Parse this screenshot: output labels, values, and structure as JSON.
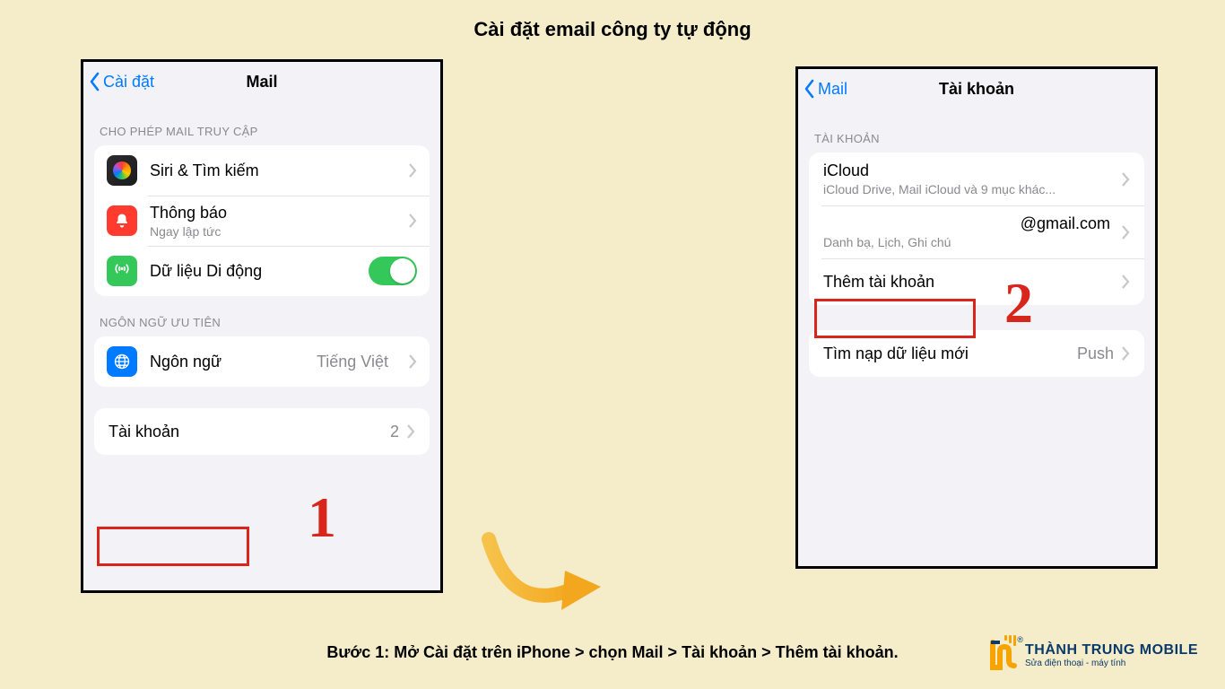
{
  "page_title": "Cài đặt email công ty tự động",
  "caption": "Bước 1: Mở Cài đặt trên iPhone > chọn Mail > Tài khoản > Thêm tài khoản.",
  "annotation": {
    "marker1": "1",
    "marker2": "2"
  },
  "phone_left": {
    "back": "Cài đặt",
    "title": "Mail",
    "section1_header": "CHO PHÉP MAIL TRUY CẬP",
    "rows1": {
      "siri": "Siri & Tìm kiếm",
      "notif_label": "Thông báo",
      "notif_sub": "Ngay lập tức",
      "cellular": "Dữ liệu Di động"
    },
    "section2_header": "NGÔN NGỮ ƯU TIÊN",
    "language_label": "Ngôn ngữ",
    "language_value": "Tiếng Việt",
    "accounts_label": "Tài khoản",
    "accounts_value": "2"
  },
  "phone_right": {
    "back": "Mail",
    "title": "Tài khoản",
    "section_header": "TÀI KHOẢN",
    "icloud_label": "iCloud",
    "icloud_sub": "iCloud Drive, Mail iCloud và 9 mục khác...",
    "gmail_label": "@gmail.com",
    "gmail_sub": "Danh bạ, Lịch, Ghi chú",
    "add_label": "Thêm tài khoản",
    "fetch_label": "Tìm nạp dữ liệu mới",
    "fetch_value": "Push"
  },
  "brand": {
    "name": "THÀNH TRUNG MOBILE",
    "tagline": "Sửa điện thoại - máy tính"
  }
}
